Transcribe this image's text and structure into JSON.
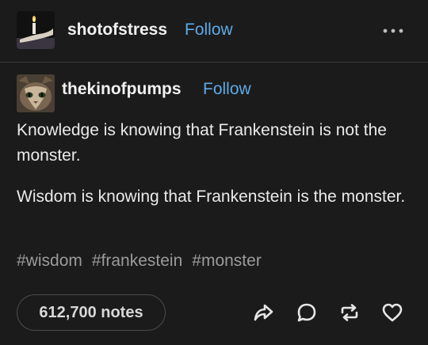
{
  "post": {
    "author": "shotofstress",
    "follow_label": "Follow",
    "reblogged_from": {
      "username": "thekinofpumps",
      "follow_label": "Follow"
    },
    "paragraphs": [
      "Knowledge is knowing that Frankenstein is not the monster.",
      "Wisdom is knowing that Frankenstein is the monster."
    ],
    "tags": [
      "#wisdom",
      "#frankestein",
      "#monster"
    ],
    "notes_label": "612,700 notes"
  },
  "icons": {
    "more": "more-horizontal-icon",
    "share": "share-icon",
    "reply": "reply-icon",
    "reblog": "reblog-icon",
    "like": "heart-icon"
  },
  "colors": {
    "background": "#1b1b1b",
    "follow_link": "#5fa9e6",
    "tag_text": "#9b9b9b"
  }
}
